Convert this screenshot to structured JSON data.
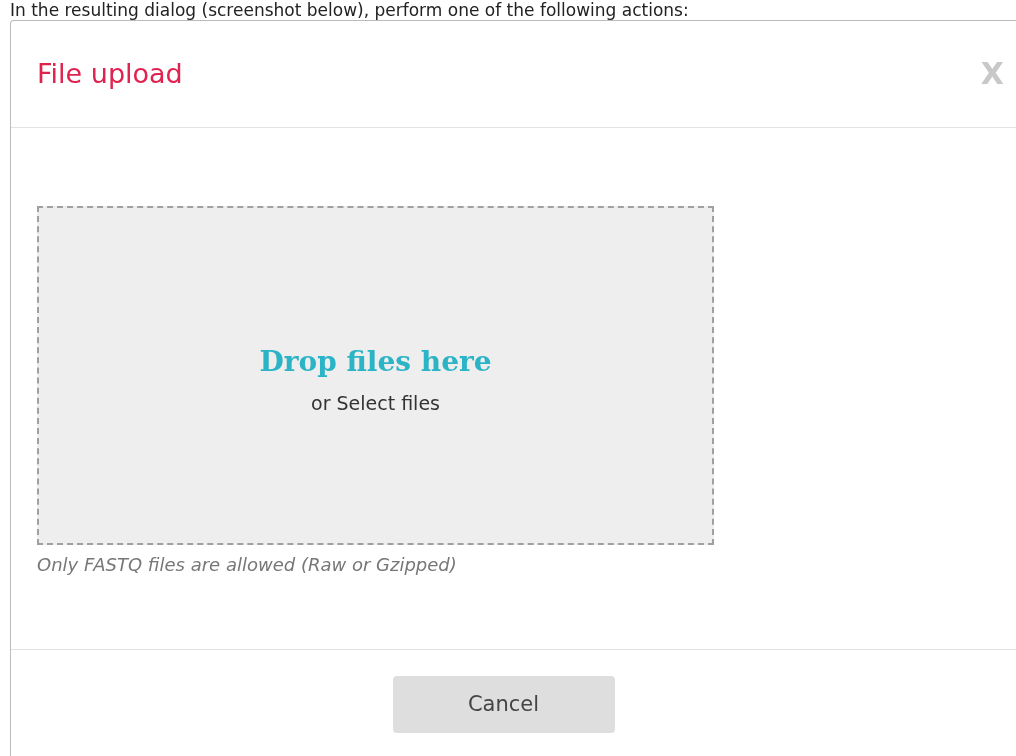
{
  "intro_text": "In the resulting dialog (screenshot below), perform one of the following actions:",
  "dialog": {
    "title": "File upload",
    "close_label": "X",
    "drop_zone": {
      "heading": "Drop files here",
      "subtext": "or Select files"
    },
    "hint": "Only FASTQ files are allowed (Raw or Gzipped)",
    "buttons": [
      {
        "label": "Cancel"
      }
    ]
  }
}
